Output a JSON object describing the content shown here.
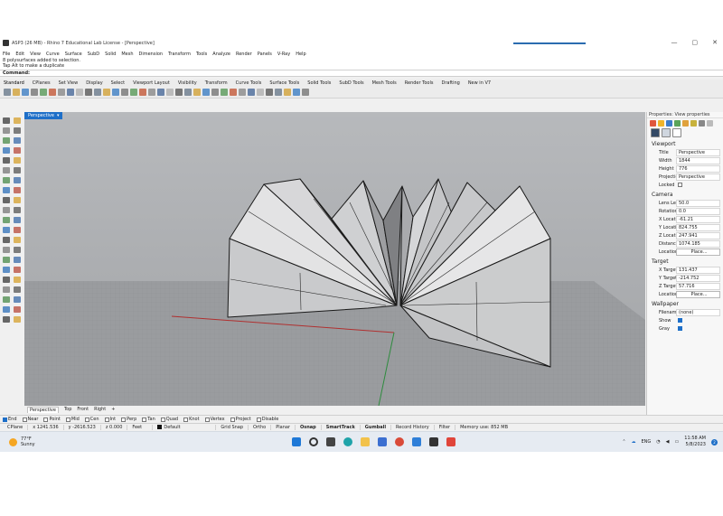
{
  "window": {
    "title": "ASP3 (26 MB) - Rhino 7 Educational Lab License - [Perspective]",
    "min": "—",
    "max": "▢",
    "close": "✕"
  },
  "menu": [
    "File",
    "Edit",
    "View",
    "Curve",
    "Surface",
    "SubD",
    "Solid",
    "Mesh",
    "Dimension",
    "Transform",
    "Tools",
    "Analyze",
    "Render",
    "Panels",
    "V-Ray",
    "Help"
  ],
  "command": {
    "history": [
      "8 polysurfaces added to selection.",
      "Tap Alt to make a duplicate"
    ],
    "prompt": "Command:"
  },
  "toolbar_tabs": [
    "Standard",
    "CPlanes",
    "Set View",
    "Display",
    "Select",
    "Viewport Layout",
    "Visibility",
    "Transform",
    "Curve Tools",
    "Surface Tools",
    "Solid Tools",
    "SubD Tools",
    "Mesh Tools",
    "Render Tools",
    "Drafting",
    "New in V7"
  ],
  "viewport": {
    "label": "Perspective",
    "dropdown": "▾",
    "view_tabs": [
      "Perspective",
      "Top",
      "Front",
      "Right"
    ],
    "add": "+"
  },
  "osnaps": [
    {
      "label": "End",
      "on": true
    },
    {
      "label": "Near",
      "on": false
    },
    {
      "label": "Point",
      "on": false
    },
    {
      "label": "Mid",
      "on": false
    },
    {
      "label": "Cen",
      "on": false
    },
    {
      "label": "Int",
      "on": false
    },
    {
      "label": "Perp",
      "on": false
    },
    {
      "label": "Tan",
      "on": false
    },
    {
      "label": "Quad",
      "on": false
    },
    {
      "label": "Knot",
      "on": false
    },
    {
      "label": "Vertex",
      "on": false
    },
    {
      "label": "Project",
      "on": false
    },
    {
      "label": "Disable",
      "on": false
    }
  ],
  "status": {
    "cplane": "CPlane",
    "x": "x 1241.536",
    "y": "y -2616.523",
    "z": "z 0.000",
    "units": "Feet",
    "layer": "Default",
    "grid_snap": "Grid Snap",
    "ortho": "Ortho",
    "planar": "Planar",
    "osnap": "Osnap",
    "smarttrack": "SmartTrack",
    "gumball": "Gumball",
    "record_history": "Record History",
    "filter": "Filter",
    "memory": "Memory use: 852 MB"
  },
  "panel": {
    "tabs": "Properties: View properties",
    "viewport_section": "Viewport",
    "viewport_rows": [
      {
        "k": "Title",
        "v": "Perspective"
      },
      {
        "k": "Width",
        "v": "1844"
      },
      {
        "k": "Height",
        "v": "776"
      },
      {
        "k": "Projection",
        "v": "Perspective"
      },
      {
        "k": "Locked",
        "v": ""
      }
    ],
    "camera_section": "Camera",
    "camera_rows": [
      {
        "k": "Lens Length...",
        "v": "50.0"
      },
      {
        "k": "Rotation",
        "v": "0.0"
      },
      {
        "k": "X Location",
        "v": "-61.21"
      },
      {
        "k": "Y Location",
        "v": "824.755"
      },
      {
        "k": "Z Location",
        "v": "247.941"
      },
      {
        "k": "Distance to...",
        "v": "1074.185"
      },
      {
        "k": "Location",
        "v": "Place..."
      }
    ],
    "target_section": "Target",
    "target_rows": [
      {
        "k": "X Target",
        "v": "131.437"
      },
      {
        "k": "Y Target",
        "v": "-214.752"
      },
      {
        "k": "Z Target",
        "v": "57.716"
      },
      {
        "k": "Location",
        "v": "Place..."
      }
    ],
    "wallpaper_section": "Wallpaper",
    "wallpaper_rows": [
      {
        "k": "Filename",
        "v": "(none)"
      },
      {
        "k": "Show",
        "v": ""
      },
      {
        "k": "Gray",
        "v": ""
      }
    ],
    "browse": "..."
  },
  "taskbar": {
    "temp": "77°F",
    "weather": "Sunny",
    "lang": "ENG",
    "time": "11:58 AM",
    "date": "5/8/2023",
    "badge": "2"
  }
}
